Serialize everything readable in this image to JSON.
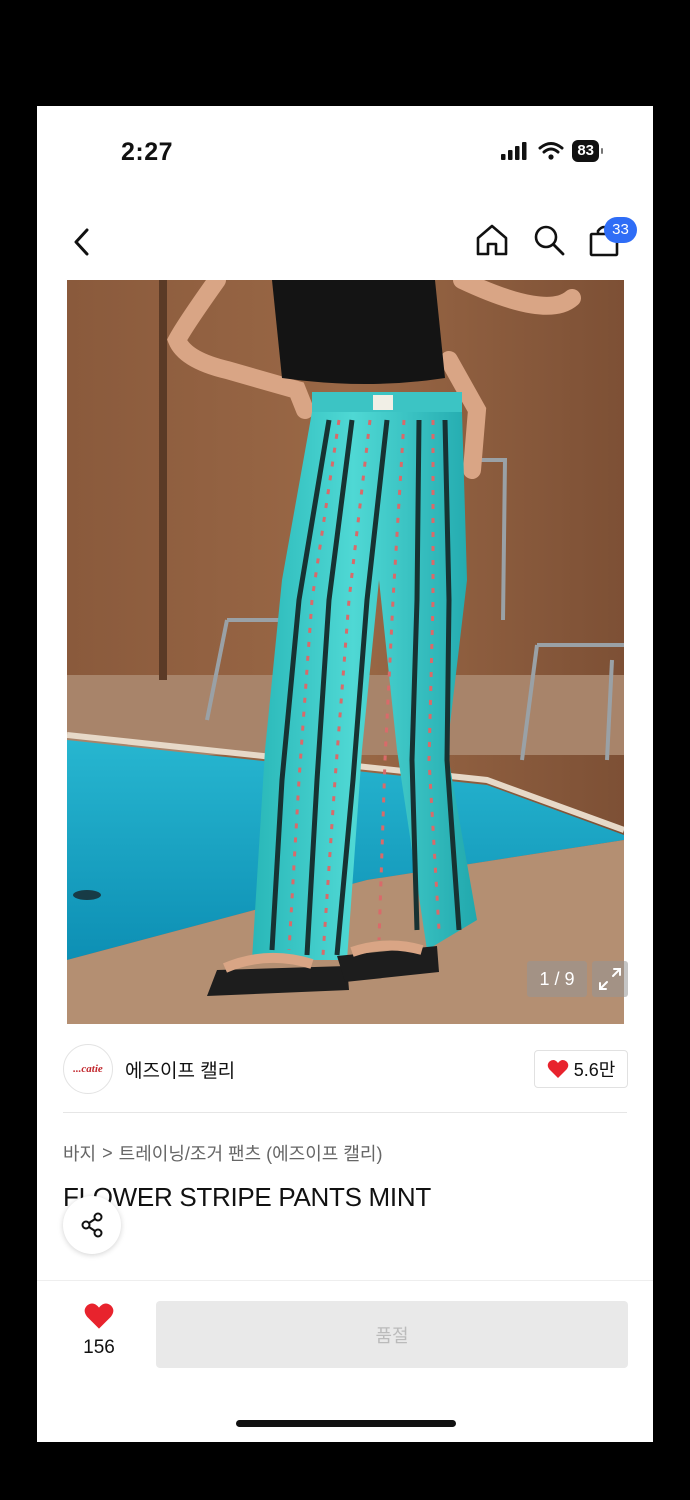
{
  "status_bar": {
    "time": "2:27",
    "battery": "83"
  },
  "nav": {
    "cart_count": "33"
  },
  "gallery": {
    "counter": "1 / 9"
  },
  "brand": {
    "logo_text": "...catie",
    "name": "에즈이프 캘리",
    "likes": "5.6만"
  },
  "breadcrumb": {
    "category": "바지",
    "separator": ">",
    "subcategory": "트레이닝/조거 팬츠 (에즈이프 캘리)"
  },
  "product": {
    "title": "FLOWER STRIPE PANTS MINT"
  },
  "bottom_bar": {
    "wish_count": "156",
    "buy_label": "품절"
  },
  "colors": {
    "accent_blue": "#2f6df6",
    "heart_red": "#e8232d",
    "pants_mint": "#2fc2c6",
    "pool_blue": "#1aa6c7"
  }
}
